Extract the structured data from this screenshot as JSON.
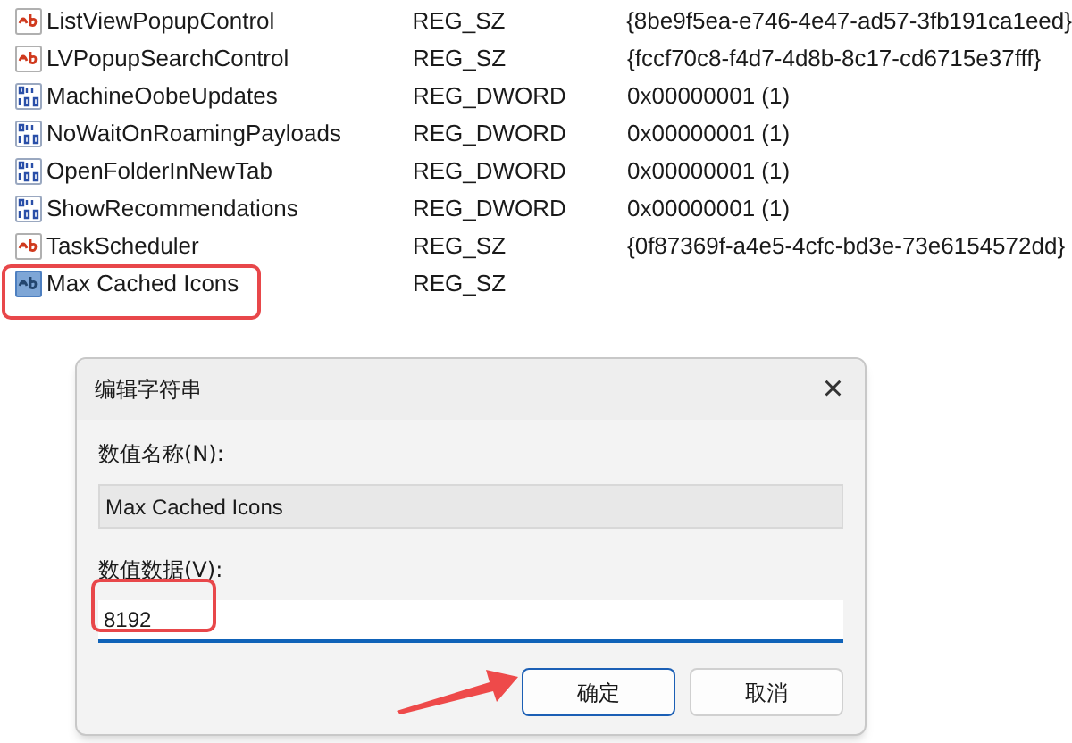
{
  "values": [
    {
      "name": "ListViewPopupControl",
      "kind": "string",
      "type": "REG_SZ",
      "data": "{8be9f5ea-e746-4e47-ad57-3fb191ca1eed}",
      "selected": false
    },
    {
      "name": "LVPopupSearchControl",
      "kind": "string",
      "type": "REG_SZ",
      "data": "{fccf70c8-f4d7-4d8b-8c17-cd6715e37fff}",
      "selected": false
    },
    {
      "name": "MachineOobeUpdates",
      "kind": "dword",
      "type": "REG_DWORD",
      "data": "0x00000001 (1)",
      "selected": false
    },
    {
      "name": "NoWaitOnRoamingPayloads",
      "kind": "dword",
      "type": "REG_DWORD",
      "data": "0x00000001 (1)",
      "selected": false
    },
    {
      "name": "OpenFolderInNewTab",
      "kind": "dword",
      "type": "REG_DWORD",
      "data": "0x00000001 (1)",
      "selected": false
    },
    {
      "name": "ShowRecommendations",
      "kind": "dword",
      "type": "REG_DWORD",
      "data": "0x00000001 (1)",
      "selected": false
    },
    {
      "name": "TaskScheduler",
      "kind": "string",
      "type": "REG_SZ",
      "data": "{0f87369f-a4e5-4cfc-bd3e-73e6154572dd}",
      "selected": false
    },
    {
      "name": "Max Cached Icons",
      "kind": "string",
      "type": "REG_SZ",
      "selected": true
    }
  ],
  "dialog": {
    "title": "编辑字符串",
    "close": "×",
    "name_label": "数值名称(N):",
    "name_value": "Max Cached Icons",
    "data_label": "数值数据(V):",
    "data_value": "8192",
    "ok": "确定",
    "cancel": "取消"
  }
}
